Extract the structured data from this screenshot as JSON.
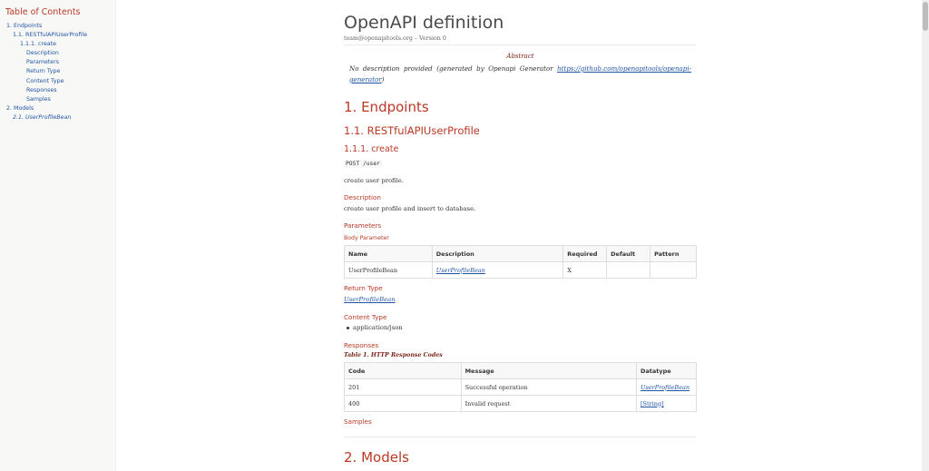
{
  "toc": {
    "title": "Table of Contents",
    "items": [
      {
        "label": "1. Endpoints"
      },
      {
        "label": "1.1. RESTfulAPIUserProfile"
      },
      {
        "label": "1.1.1. create"
      },
      {
        "label": "Description"
      },
      {
        "label": "Parameters"
      },
      {
        "label": "Return Type"
      },
      {
        "label": "Content Type"
      },
      {
        "label": "Responses"
      },
      {
        "label": "Samples"
      },
      {
        "label": "2. Models"
      },
      {
        "label": "2.1. UserProfileBean"
      }
    ]
  },
  "header": {
    "title": "OpenAPI definition",
    "details": "team@openapitools.org – Version 0"
  },
  "abstract": {
    "title": "Abstract",
    "text": "No description provided (generated by Openapi Generator ",
    "link": "https://github.com/openapitools/openapi-generator",
    "text_end": ")"
  },
  "endpoints": {
    "heading": "1. Endpoints",
    "resource": "1.1. RESTfulAPIUserProfile",
    "operation": "1.1.1. create",
    "method_path": "POST /user",
    "summary": "create user profile.",
    "description_heading": "Description",
    "description": "create user profile and insert to database.",
    "parameters_heading": "Parameters",
    "body_parameter_heading": "Body Parameter",
    "params_table": {
      "headers": [
        "Name",
        "Description",
        "Required",
        "Default",
        "Pattern"
      ],
      "rows": [
        [
          "UserProfileBean",
          "UserProfileBean",
          "X",
          "",
          ""
        ]
      ]
    },
    "return_type_heading": "Return Type",
    "return_type": "UserProfileBean",
    "content_type_heading": "Content Type",
    "content_type": "application/json",
    "responses_heading": "Responses",
    "responses_caption": "Table 1. HTTP Response Codes",
    "responses_table": {
      "headers": [
        "Code",
        "Message",
        "Datatype"
      ],
      "rows": [
        [
          "201",
          "Successful operation",
          "UserProfileBean"
        ],
        [
          "400",
          "Invalid request",
          "[String]"
        ]
      ]
    },
    "samples_heading": "Samples"
  },
  "models": {
    "heading": "2. Models"
  },
  "colors": {
    "heading": "#ba3925",
    "link": "#2156a5",
    "sidebar_bg": "#f8f8f7"
  }
}
